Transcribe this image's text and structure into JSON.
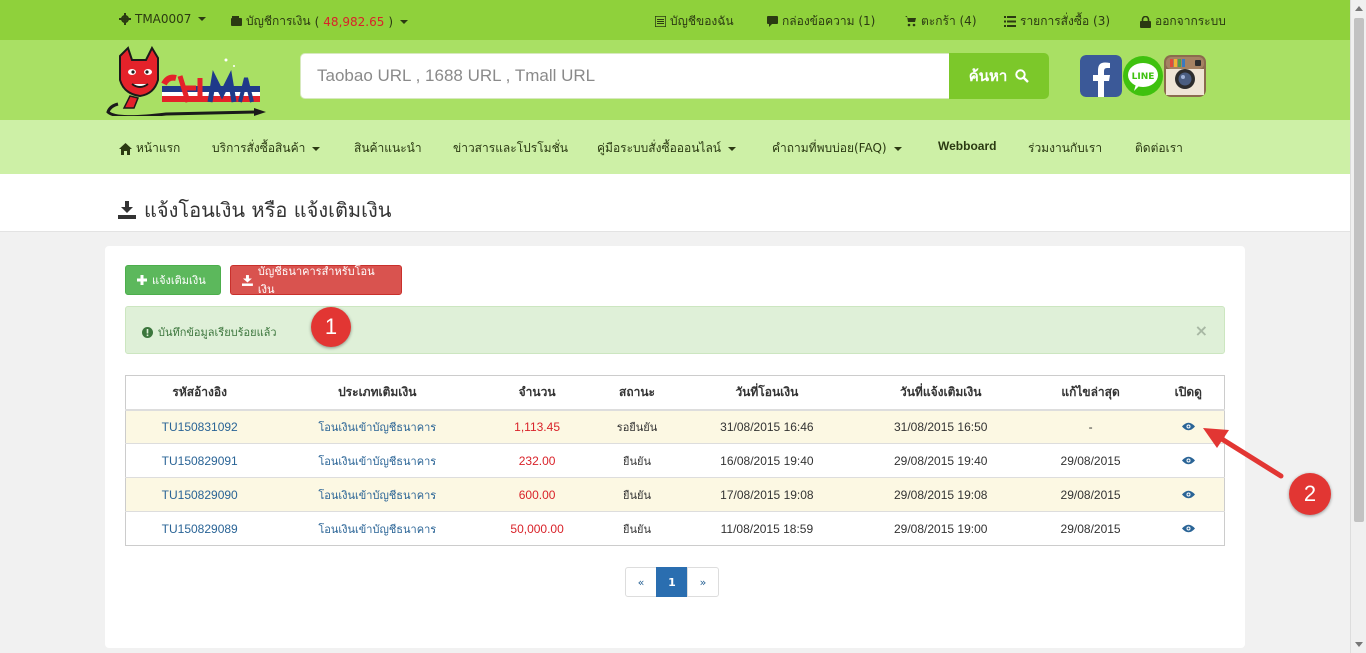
{
  "topbar": {
    "user": "TMA0007",
    "account_label": "บัญชีการเงิน",
    "balance_open": "(",
    "balance": "48,982.65",
    "balance_close": ")",
    "my_account": "บัญชีของฉัน",
    "inbox": "กล่องข้อความ (1)",
    "cart": "ตะกร้า (4)",
    "orders": "รายการสั่งซื้อ (3)",
    "logout": "ออกจากระบบ"
  },
  "header": {
    "search_placeholder": "Taobao URL , 1688 URL , Tmall URL",
    "search_button": "ค้นหา"
  },
  "nav": {
    "items": [
      {
        "label": "หน้าแรก"
      },
      {
        "label": "บริการสั่งซื้อสินค้า"
      },
      {
        "label": "สินค้าแนะนำ"
      },
      {
        "label": "ข่าวสารและโปรโมชั่น"
      },
      {
        "label": "คู่มือระบบสั่งซื้อออนไลน์"
      },
      {
        "label": "คำถามที่พบบ่อย(FAQ)"
      },
      {
        "label": "Webboard"
      },
      {
        "label": "ร่วมงานกับเรา"
      },
      {
        "label": "ติดต่อเรา"
      }
    ]
  },
  "page": {
    "title": "แจ้งโอนเงิน หรือ แจ้งเติมเงิน"
  },
  "buttons": {
    "topup": "แจ้งเติมเงิน",
    "bank_accounts": "บัญชีธนาคารสำหรับโอนเงิน"
  },
  "alert": {
    "message": "บันทึกข้อมูลเรียบร้อยแล้ว",
    "close": "×"
  },
  "annotations": {
    "one": "1",
    "two": "2"
  },
  "table": {
    "headers": [
      "รหัสอ้างอิง",
      "ประเภทเติมเงิน",
      "จำนวน",
      "สถานะ",
      "วันที่โอนเงิน",
      "วันที่แจ้งเติมเงิน",
      "แก้ไขล่าสุด",
      "เปิดดู"
    ],
    "rows": [
      {
        "ref": "TU150831092",
        "type": "โอนเงินเข้าบัญชีธนาคาร",
        "amount": "1,113.45",
        "status": "รอยืนยัน",
        "transfer_date": "31/08/2015 16:46",
        "notify_date": "31/08/2015 16:50",
        "updated": "-"
      },
      {
        "ref": "TU150829091",
        "type": "โอนเงินเข้าบัญชีธนาคาร",
        "amount": "232.00",
        "status": "ยืนยัน",
        "transfer_date": "16/08/2015 19:40",
        "notify_date": "29/08/2015 19:40",
        "updated": "29/08/2015"
      },
      {
        "ref": "TU150829090",
        "type": "โอนเงินเข้าบัญชีธนาคาร",
        "amount": "600.00",
        "status": "ยืนยัน",
        "transfer_date": "17/08/2015 19:08",
        "notify_date": "29/08/2015 19:08",
        "updated": "29/08/2015"
      },
      {
        "ref": "TU150829089",
        "type": "โอนเงินเข้าบัญชีธนาคาร",
        "amount": "50,000.00",
        "status": "ยืนยัน",
        "transfer_date": "11/08/2015 18:59",
        "notify_date": "29/08/2015 19:00",
        "updated": "29/08/2015"
      }
    ]
  },
  "pager": {
    "prev": "«",
    "current": "1",
    "next": "»"
  },
  "colors": {
    "topbar": "#8fd13b",
    "header": "#a9e064",
    "nav": "#cdf0a6",
    "accent_red": "#d9232a",
    "badge_red": "#e23633"
  },
  "icons": [
    "gear-icon",
    "wallet-icon",
    "list-icon",
    "comment-icon",
    "cart-icon",
    "list-ul-icon",
    "lock-icon",
    "search-icon",
    "home-icon",
    "download-icon",
    "plus-icon",
    "info-icon",
    "eye-icon",
    "facebook-icon",
    "line-icon",
    "instagram-icon"
  ]
}
